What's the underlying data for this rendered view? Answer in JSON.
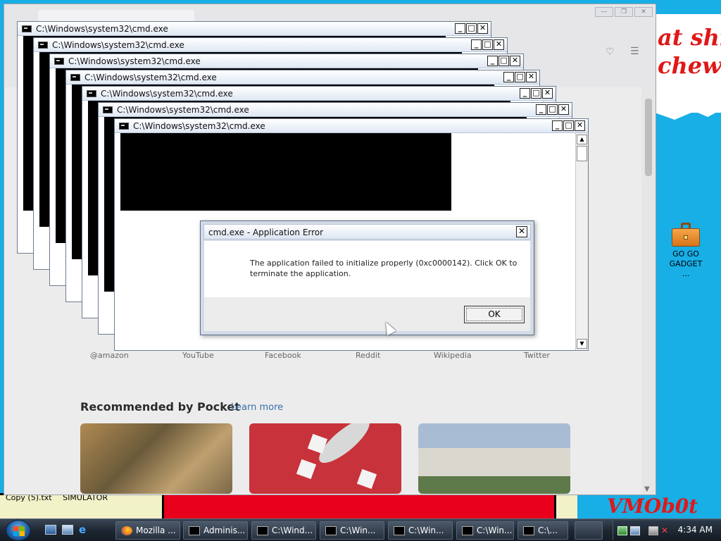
{
  "wallpaper": {
    "slogan_line1": "at shit",
    "slogan_line2": "chew",
    "signature": "VMOb0t",
    "colors": {
      "sky": "#18aee6",
      "red": "#e8001c",
      "slogan": "#e01818"
    }
  },
  "desktop": {
    "icon_label": "GO GO GADGET ...",
    "bottom_files": [
      "Copy (5).txt",
      "SIMULATOR"
    ]
  },
  "browser": {
    "shortcut_labels": [
      "@amazon",
      "YouTube",
      "Facebook",
      "Reddit",
      "Wikipedia",
      "Twitter"
    ],
    "pocket_heading": "Recommended by Pocket",
    "pocket_link": "Learn more"
  },
  "cmd_windows": [
    {
      "title": "C:\\Windows\\system32\\cmd.exe"
    },
    {
      "title": "C:\\Windows\\system32\\cmd.exe"
    },
    {
      "title": "C:\\Windows\\system32\\cmd.exe"
    },
    {
      "title": "C:\\Windows\\system32\\cmd.exe"
    },
    {
      "title": "C:\\Windows\\system32\\cmd.exe"
    },
    {
      "title": "C:\\Windows\\system32\\cmd.exe"
    },
    {
      "title": "C:\\Windows\\system32\\cmd.exe"
    }
  ],
  "dialog": {
    "title": "cmd.exe - Application Error",
    "message": "The application failed to initialize properly (0xc0000142). Click OK to terminate the application.",
    "ok_label": "OK",
    "close_glyph": "✕"
  },
  "taskbar": {
    "tasks": [
      {
        "label": "Mozilla ...",
        "icon": "firefox-icon"
      },
      {
        "label": "Adminis...",
        "icon": "cmd-icon"
      },
      {
        "label": "C:\\Wind...",
        "icon": "cmd-icon"
      },
      {
        "label": "C:\\Win...",
        "icon": "cmd-icon"
      },
      {
        "label": "C:\\Win...",
        "icon": "cmd-icon"
      },
      {
        "label": "C:\\Win...",
        "icon": "cmd-icon"
      },
      {
        "label": "C:\\...",
        "icon": "cmd-icon"
      }
    ],
    "clock": "4:34 AM"
  }
}
